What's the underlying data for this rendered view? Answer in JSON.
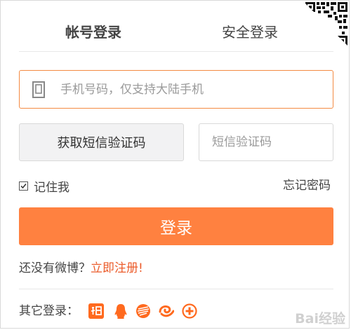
{
  "tabs": [
    {
      "label": "帐号登录",
      "active": true
    },
    {
      "label": "安全登录",
      "active": false
    }
  ],
  "phone": {
    "placeholder": "手机号码，仅支持大陆手机",
    "value": ""
  },
  "sms": {
    "button_label": "获取短信验证码",
    "placeholder": "短信验证码",
    "value": ""
  },
  "remember": {
    "label": "记住我",
    "checked": true
  },
  "forgot_label": "忘记密码",
  "login_label": "登录",
  "register": {
    "prompt": "还没有微博？",
    "link": "立即注册!"
  },
  "other_login": {
    "label": "其它登录：",
    "providers": [
      "taobao-icon",
      "qq-icon",
      "china-mobile-icon",
      "tianyi-icon",
      "baidu-plus-icon"
    ]
  },
  "watermark": "Bai经验",
  "colors": {
    "accent": "#ff8140",
    "link": "#eb5b2a",
    "focus_border": "#f48a42"
  }
}
